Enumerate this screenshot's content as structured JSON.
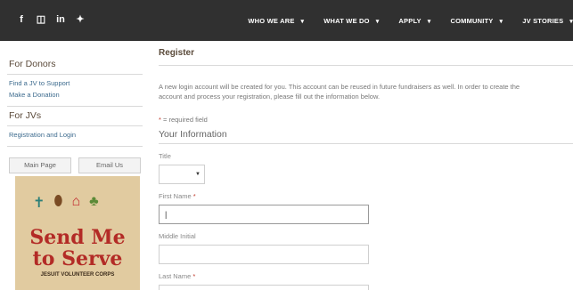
{
  "social": {
    "icons": [
      {
        "name": "facebook-icon",
        "glyph": "f"
      },
      {
        "name": "instagram-icon",
        "glyph": "◫"
      },
      {
        "name": "linkedin-icon",
        "glyph": "in"
      },
      {
        "name": "twitter-icon",
        "glyph": "✦"
      }
    ]
  },
  "nav": {
    "items": [
      {
        "label": "WHO WE ARE",
        "caret": "▾"
      },
      {
        "label": "WHAT WE DO",
        "caret": "▾"
      },
      {
        "label": "APPLY",
        "caret": "▾"
      },
      {
        "label": "COMMUNITY",
        "caret": "▾"
      },
      {
        "label": "JV STORIES",
        "caret": "▾"
      }
    ]
  },
  "sidebar": {
    "donors_heading": "For Donors",
    "donor_links": [
      "Find a JV to Support",
      "Make a Donation"
    ],
    "jvs_heading": "For JVs",
    "jv_links": [
      "Registration and Login"
    ],
    "main_page_button": "Main Page",
    "email_button": "Email Us"
  },
  "promo": {
    "line1": "Send Me",
    "line2": "to Serve",
    "org": "JESUIT VOLUNTEER CORPS"
  },
  "main": {
    "title": "Register",
    "intro_line1": "A new login account will be created for you. This account can be reused in future fundraisers as well. In order to create the",
    "intro_line2": "account and process your registration, please fill out the information below.",
    "required_star": "*",
    "required_note": " = required field",
    "section_title": "Your Information",
    "fields": {
      "title_label": "Title",
      "first_name_label": "First Name",
      "middle_initial_label": "Middle Initial",
      "last_name_label": "Last Name",
      "first_name_value": "|"
    }
  },
  "colors": {
    "topbar": "#303030",
    "link": "#3d6b8e",
    "required": "#c0392b",
    "promo_bg": "#e1cba0",
    "promo_text": "#b32b26"
  }
}
